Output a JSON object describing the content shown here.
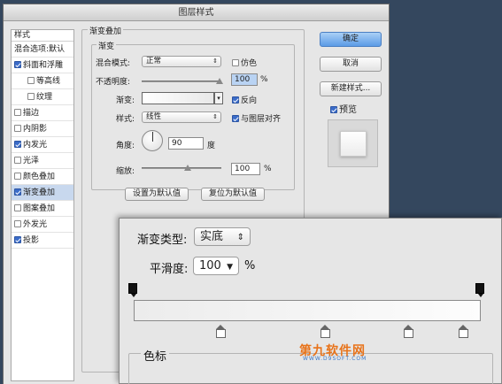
{
  "window": {
    "title": "图层样式"
  },
  "styles_panel": {
    "header": "样式",
    "blending": "混合选项:默认",
    "items": [
      {
        "label": "斜面和浮雕",
        "checked": true,
        "sub": false,
        "selected": false
      },
      {
        "label": "等高线",
        "checked": false,
        "sub": true,
        "selected": false
      },
      {
        "label": "纹理",
        "checked": false,
        "sub": true,
        "selected": false
      },
      {
        "label": "描边",
        "checked": false,
        "sub": false,
        "selected": false
      },
      {
        "label": "内阴影",
        "checked": false,
        "sub": false,
        "selected": false
      },
      {
        "label": "内发光",
        "checked": true,
        "sub": false,
        "selected": false
      },
      {
        "label": "光泽",
        "checked": false,
        "sub": false,
        "selected": false
      },
      {
        "label": "颜色叠加",
        "checked": false,
        "sub": false,
        "selected": false
      },
      {
        "label": "渐变叠加",
        "checked": true,
        "sub": false,
        "selected": true
      },
      {
        "label": "图案叠加",
        "checked": false,
        "sub": false,
        "selected": false
      },
      {
        "label": "外发光",
        "checked": false,
        "sub": false,
        "selected": false
      },
      {
        "label": "投影",
        "checked": true,
        "sub": false,
        "selected": false
      }
    ]
  },
  "gradient_overlay": {
    "section_title": "渐变叠加",
    "group_title": "渐变",
    "blend_mode_label": "混合模式:",
    "blend_mode_value": "正常",
    "dither_label": "仿色",
    "dither_checked": false,
    "opacity_label": "不透明度:",
    "opacity_value": "100",
    "opacity_unit": "%",
    "gradient_label": "渐变:",
    "reverse_label": "反向",
    "reverse_checked": true,
    "style_label": "样式:",
    "style_value": "线性",
    "align_label": "与图层对齐",
    "align_checked": true,
    "angle_label": "角度:",
    "angle_value": "90",
    "angle_unit": "度",
    "scale_label": "缩放:",
    "scale_value": "100",
    "scale_unit": "%",
    "make_default": "设置为默认值",
    "reset_default": "复位为默认值"
  },
  "right_buttons": {
    "ok": "确定",
    "cancel": "取消",
    "new_style": "新建样式...",
    "preview_label": "预览",
    "preview_checked": true
  },
  "gradient_editor": {
    "type_label": "渐变类型:",
    "type_value": "实底",
    "smoothness_label": "平滑度:",
    "smoothness_value": "100",
    "smoothness_unit": "%",
    "color_stops_label": "色标",
    "opacity_stop_positions": [
      0,
      1
    ],
    "color_stop_positions": [
      0.25,
      0.55,
      0.79,
      0.95
    ]
  },
  "watermark": {
    "text": "第九软件网",
    "url": "WWW.D9SOFT.COM"
  }
}
